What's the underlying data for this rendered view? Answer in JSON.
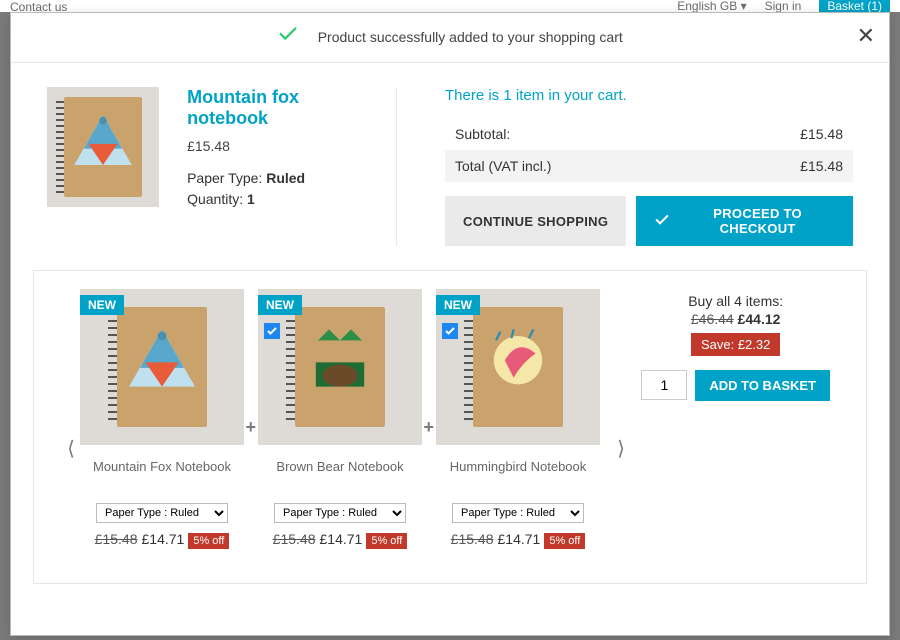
{
  "topbar": {
    "contact": "Contact us",
    "language": "English GB",
    "signin": "Sign in",
    "basket": "Basket (1)"
  },
  "modal": {
    "success_msg": "Product successfully added to your shopping cart",
    "close_label": "✕"
  },
  "product": {
    "title": "Mountain fox notebook",
    "price": "£15.48",
    "option_label": "Paper Type:",
    "option_value": "Ruled",
    "qty_label": "Quantity:",
    "qty_value": "1"
  },
  "cart": {
    "heading": "There is 1 item in your cart.",
    "subtotal_label": "Subtotal:",
    "subtotal_value": "£15.48",
    "total_label": "Total (VAT incl.)",
    "total_value": "£15.48",
    "continue_label": "CONTINUE SHOPPING",
    "checkout_label": "PROCEED TO CHECKOUT"
  },
  "bundle": {
    "buy_all_label": "Buy all 4 items:",
    "old_total": "£46.44",
    "new_total": "£44.12",
    "save_label": "Save: £2.32",
    "qty_value": "1",
    "add_label": "ADD TO BASKET",
    "items": [
      {
        "name": "Mountain Fox Notebook",
        "badge": "NEW",
        "checked": false,
        "select_value": "Paper Type : Ruled",
        "old_price": "£15.48",
        "new_price": "£14.71",
        "discount": "5% off"
      },
      {
        "name": "Brown Bear Notebook",
        "badge": "NEW",
        "checked": true,
        "select_value": "Paper Type : Ruled",
        "old_price": "£15.48",
        "new_price": "£14.71",
        "discount": "5% off"
      },
      {
        "name": "Hummingbird Notebook",
        "badge": "NEW",
        "checked": true,
        "select_value": "Paper Type : Ruled",
        "old_price": "£15.48",
        "new_price": "£14.71",
        "discount": "5% off"
      }
    ]
  }
}
